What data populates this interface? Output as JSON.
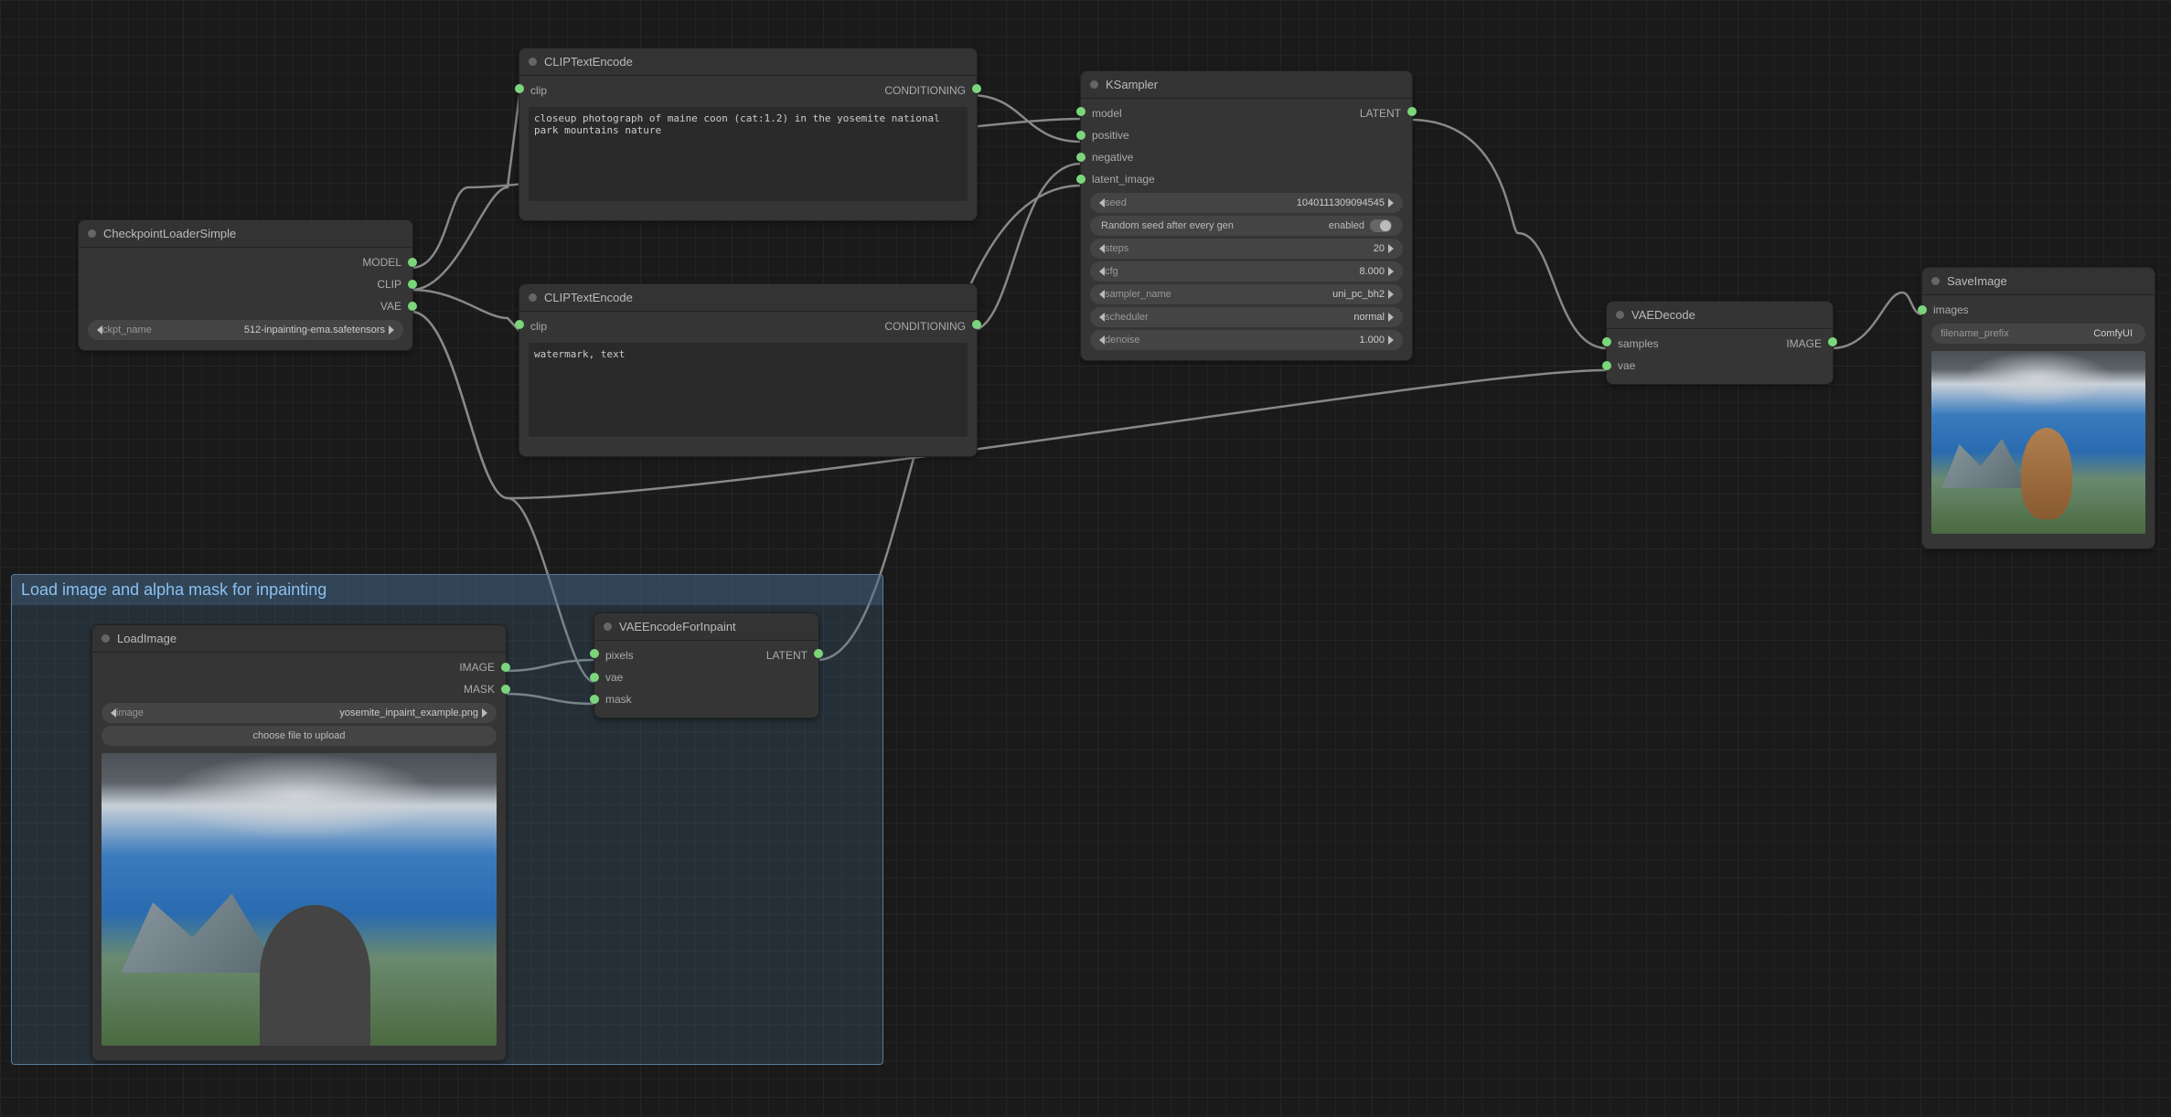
{
  "group": {
    "title": "Load image and alpha mask for inpainting"
  },
  "nodes": {
    "ckpt": {
      "title": "CheckpointLoaderSimple",
      "outputs": [
        "MODEL",
        "CLIP",
        "VAE"
      ],
      "widget": {
        "label": "ckpt_name",
        "value": "512-inpainting-ema.safetensors"
      }
    },
    "clip1": {
      "title": "CLIPTextEncode",
      "input": "clip",
      "output": "CONDITIONING",
      "text": "closeup photograph of maine coon (cat:1.2) in the yosemite national park mountains nature"
    },
    "clip2": {
      "title": "CLIPTextEncode",
      "input": "clip",
      "output": "CONDITIONING",
      "text": "watermark, text"
    },
    "loadimage": {
      "title": "LoadImage",
      "outputs": [
        "IMAGE",
        "MASK"
      ],
      "widget": {
        "label": "image",
        "value": "yosemite_inpaint_example.png"
      },
      "button": "choose file to upload"
    },
    "vaeenc": {
      "title": "VAEEncodeForInpaint",
      "inputs": [
        "pixels",
        "vae",
        "mask"
      ],
      "output": "LATENT"
    },
    "ksampler": {
      "title": "KSampler",
      "inputs": [
        "model",
        "positive",
        "negative",
        "latent_image"
      ],
      "output": "LATENT",
      "widgets": [
        {
          "label": "seed",
          "value": "1040111309094545"
        },
        {
          "type": "toggle",
          "label": "Random seed after every gen",
          "value": "enabled"
        },
        {
          "label": "steps",
          "value": "20"
        },
        {
          "label": "cfg",
          "value": "8.000"
        },
        {
          "label": "sampler_name",
          "value": "uni_pc_bh2"
        },
        {
          "label": "scheduler",
          "value": "normal"
        },
        {
          "label": "denoise",
          "value": "1.000"
        }
      ]
    },
    "vaedec": {
      "title": "VAEDecode",
      "inputs": [
        "samples",
        "vae"
      ],
      "output": "IMAGE"
    },
    "saveimage": {
      "title": "SaveImage",
      "input": "images",
      "widget": {
        "label": "filename_prefix",
        "value": "ComfyUI"
      }
    }
  }
}
